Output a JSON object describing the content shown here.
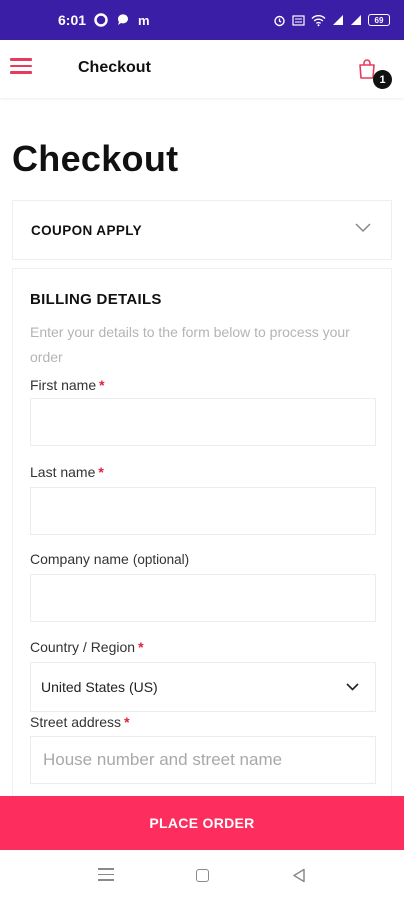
{
  "status_bar": {
    "time": "6:01",
    "left_icons": [
      "notification-circle-icon",
      "chat-bubble-icon",
      "gmail-m-icon"
    ],
    "m_glyph": "m",
    "right_icons": [
      "alarm-icon",
      "data-speed-icon",
      "wifi-icon",
      "signal-icon",
      "signal-icon",
      "battery-icon"
    ],
    "battery_text": "69"
  },
  "app_bar": {
    "title": "Checkout",
    "menu_icon": "hamburger-menu-icon",
    "cart_icon": "shopping-bag-icon",
    "cart_count": "1"
  },
  "page": {
    "title": "Checkout"
  },
  "coupon": {
    "label": "COUPON APPLY",
    "icon": "chevron-down-icon"
  },
  "billing": {
    "title": "BILLING DETAILS",
    "description": "Enter your details to the form below to process your order",
    "fields": {
      "first_name": {
        "label": "First name",
        "required": "*",
        "value": ""
      },
      "last_name": {
        "label": "Last name",
        "required": "*",
        "value": ""
      },
      "company": {
        "label": "Company name",
        "optional": "(optional)",
        "value": ""
      },
      "country": {
        "label": "Country / Region",
        "required": "*",
        "selected": "United States (US)"
      },
      "street": {
        "label": "Street address",
        "required": "*",
        "placeholder": "House number and street name"
      }
    }
  },
  "actions": {
    "place_order": "PLACE ORDER"
  },
  "colors": {
    "accent": "#fd2d5e",
    "menu_icon": "#e83a5d",
    "status_bar": "#3a1ea6",
    "required": "#e3203a"
  }
}
